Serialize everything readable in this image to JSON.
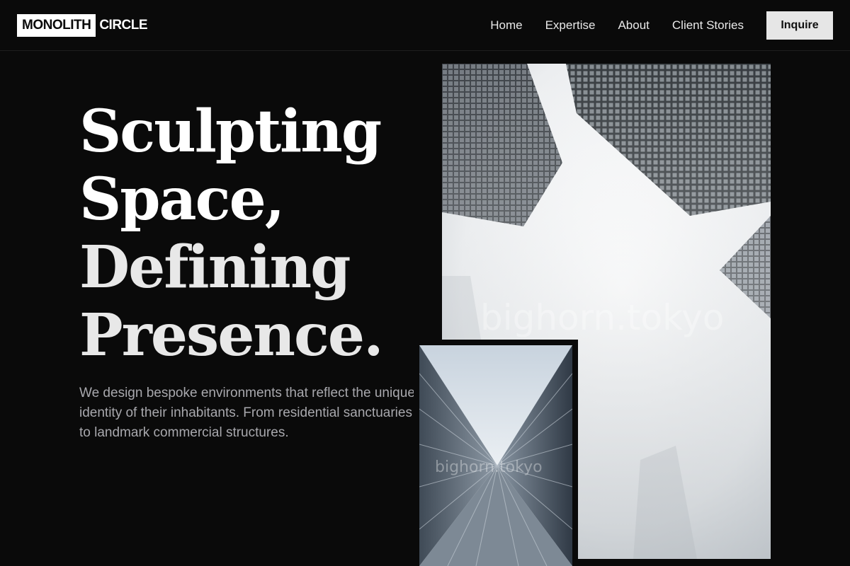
{
  "brand": {
    "part1": "MONOLITH",
    "part2": "CIRCLE"
  },
  "nav": {
    "links": [
      {
        "label": "Home"
      },
      {
        "label": "Expertise"
      },
      {
        "label": "About"
      },
      {
        "label": "Client Stories"
      }
    ],
    "cta_label": "Inquire"
  },
  "hero": {
    "headline": [
      "Sculpting",
      "Space,",
      "Defining",
      "Presence."
    ],
    "description": "We design bespoke environments that reflect the unique identity of their inhabitants. From residential sanctuaries to landmark commercial structures."
  },
  "images": {
    "main_watermark": "bighorn.tokyo",
    "small_watermark": "bighorn.tokyo"
  }
}
